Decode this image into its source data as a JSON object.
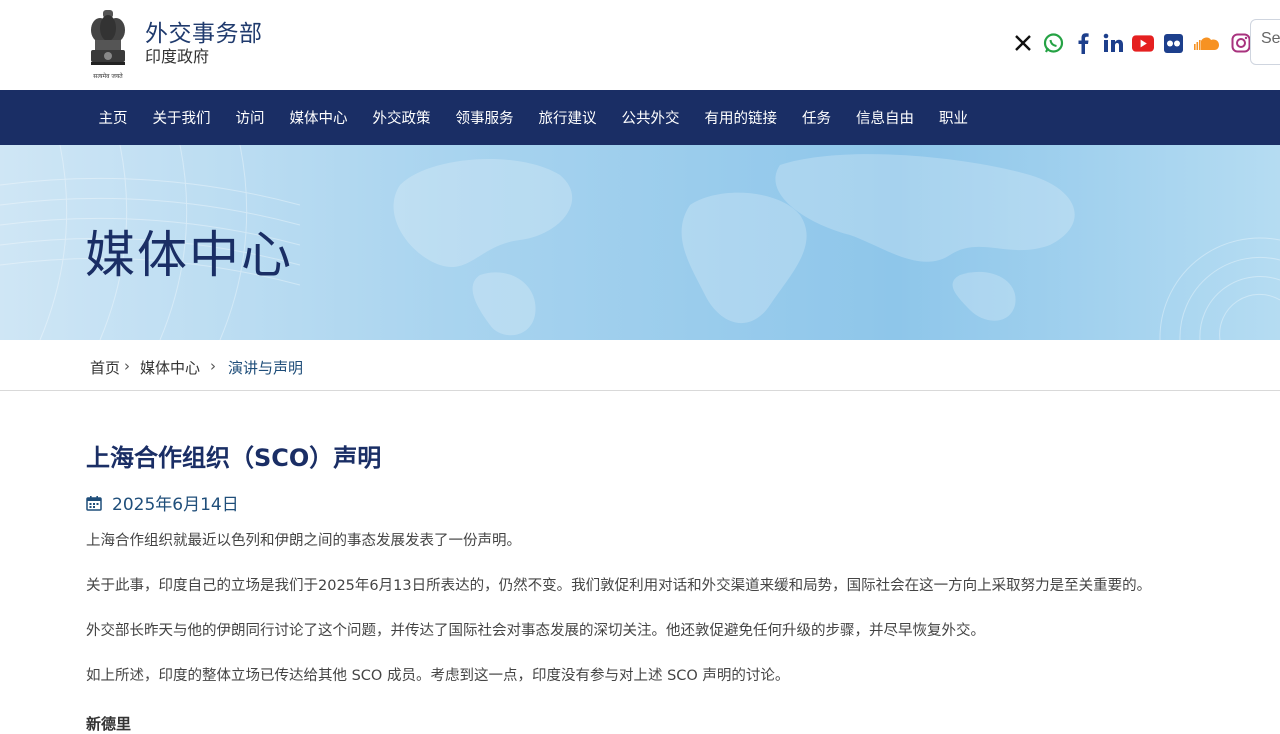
{
  "header": {
    "site_title": "外交事务部",
    "site_subtitle": "印度政府",
    "emblem_motto": "सत्यमेव जयते",
    "search_placeholder": "Se",
    "social_icons": [
      "x-icon",
      "whatsapp-icon",
      "facebook-icon",
      "linkedin-icon",
      "youtube-icon",
      "flickr-icon",
      "soundcloud-icon",
      "instagram-icon"
    ]
  },
  "nav": {
    "items": [
      "主页",
      "关于我们",
      "访问",
      "媒体中心",
      "外交政策",
      "领事服务",
      "旅行建议",
      "公共外交",
      "有用的链接",
      "任务",
      "信息自由",
      "职业"
    ]
  },
  "banner": {
    "title": "媒体中心"
  },
  "breadcrumb": {
    "home": "首页",
    "section": "媒体中心",
    "current": "演讲与声明",
    "separator": "›"
  },
  "article": {
    "title": "上海合作组织（SCO）声明",
    "date": "2025年6月14日",
    "paragraphs": [
      "上海合作组织就最近以色列和伊朗之间的事态发展发表了一份声明。",
      "关于此事，印度自己的立场是我们于2025年6月13日所表达的，仍然不变。我们敦促利用对话和外交渠道来缓和局势，国际社会在这一方向上采取努力是至关重要的。",
      "外交部长昨天与他的伊朗同行讨论了这个问题，并传达了国际社会对事态发展的深切关注。他还敦促避免任何升级的步骤，并尽早恢复外交。",
      "如上所述，印度的整体立场已传达给其他 SCO 成员。考虑到这一点，印度没有参与对上述 SCO 声明的讨论。"
    ],
    "signoff": "新德里"
  },
  "colors": {
    "nav_bg": "#1a2e65",
    "title": "#1a2e65",
    "link": "#1f4e7a"
  }
}
